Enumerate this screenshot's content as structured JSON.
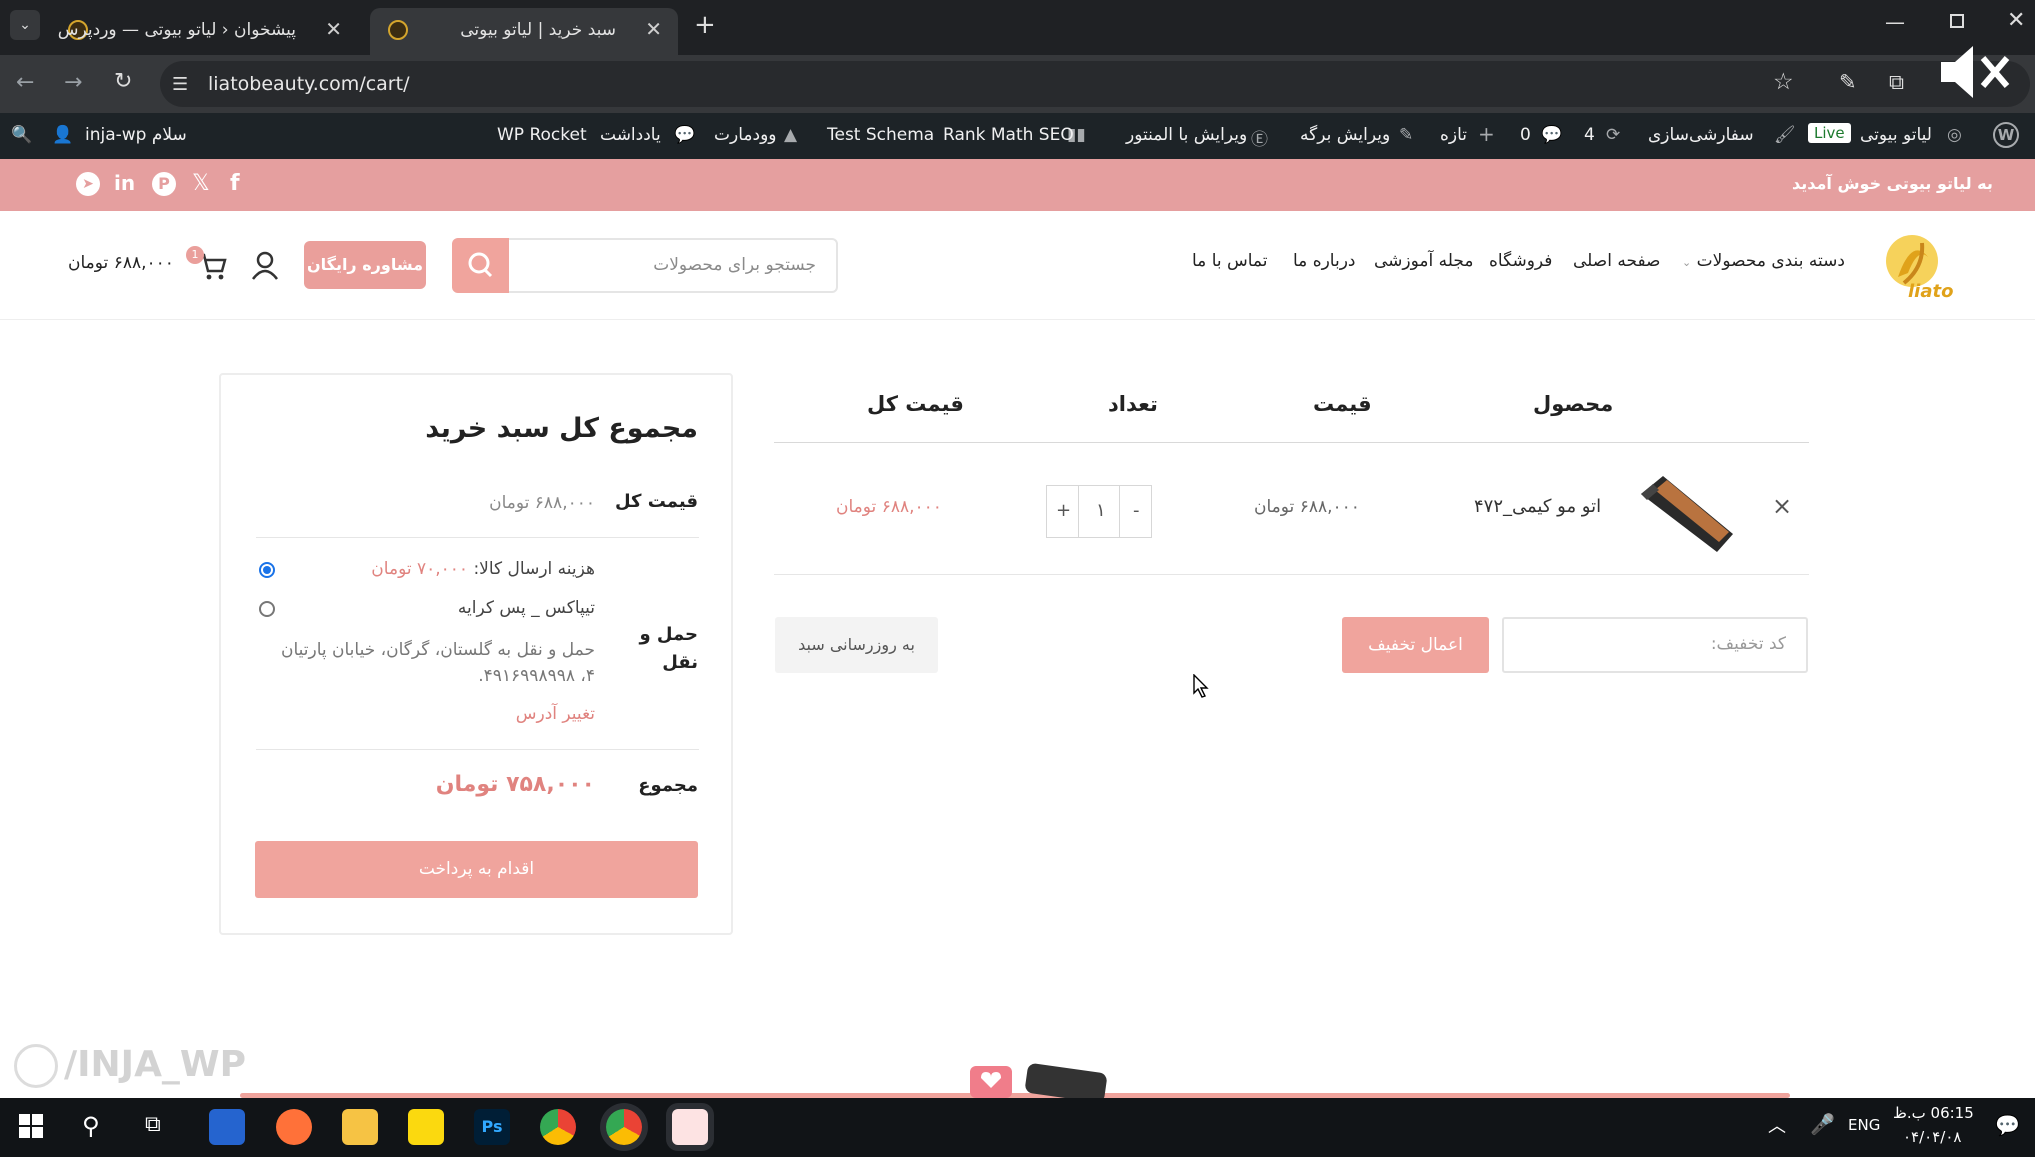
{
  "browser": {
    "tabs": [
      {
        "title": "پیشخوان ‹ لیاتو بیوتی — وردپرس"
      },
      {
        "title": "سبد خرید | لیاتو بیوتی"
      }
    ],
    "url": "liatobeauty.com/cart/"
  },
  "wp_admin_bar": {
    "site_name": "لیاتو بیوتی",
    "live_badge": "Live",
    "customize": "سفارشی‌سازی",
    "updates_count": "4",
    "comments_count": "0",
    "new": "تازه",
    "edit_page": "ویرایش برگه",
    "edit_elementor": "ویرایش با المنتور",
    "rank_math": "Rank Math SEO",
    "test_schema": "Test Schema",
    "woodmart": "وودمارت",
    "notes": "یادداشت",
    "wp_rocket": "WP Rocket",
    "greeting": "سلام inja-wp"
  },
  "site": {
    "welcome": "به لیاتو بیوتی خوش آمدید",
    "logo_text": "liato",
    "nav": [
      "دسته بندی محصولات",
      "صفحه اصلی",
      "فروشگاه",
      "مجله آموزشی",
      "درباره ما",
      "تماس با ما"
    ],
    "search_placeholder": "جستجو برای محصولات",
    "consult_button": "مشاوره رایگان",
    "cart_count": "1",
    "cart_total": "۶۸۸,۰۰۰",
    "currency": "تومان"
  },
  "cart": {
    "headers": {
      "product": "محصول",
      "price": "قیمت",
      "quantity": "تعداد",
      "subtotal": "قیمت کل"
    },
    "items": [
      {
        "name": "اتو مو کیمی_۴۷۲",
        "price": "۶۸۸,۰۰۰ تومان",
        "quantity": "۱",
        "subtotal": "۶۸۸,۰۰۰ تومان"
      }
    ],
    "qty_minus": "-",
    "qty_plus": "+",
    "remove": "×",
    "coupon_placeholder": "کد تخفیف:",
    "apply_coupon": "اعمال تخفیف",
    "update_cart": "به روزرسانی سبد"
  },
  "totals": {
    "title": "مجموع کل سبد خرید",
    "subtotal_label": "قیمت کل",
    "subtotal_value": "۶۸۸,۰۰۰ تومان",
    "shipping_label": "حمل و نقل",
    "shipping_option1_label": "هزینه ارسال کالا:",
    "shipping_option1_price": "۷۰,۰۰۰ تومان",
    "shipping_option1_selected": true,
    "shipping_option2_label": "تیپاکس _ پس کرایه",
    "shipping_address": "حمل و نقل به گلستان، گرگان، خیابان پارتیان ۴، ۴۹۱۶۹۹۸۹۹۸.",
    "change_address": "تغییر آدرس",
    "total_label": "مجموع",
    "total_value": "۷۵۸,۰۰۰ تومان",
    "checkout_button": "اقدام به پرداخت"
  },
  "watermark": "/INJA_WP",
  "taskbar": {
    "language": "ENG",
    "time": "06:15 ب.ظ",
    "date": "۰۴/۰۴/۰۸"
  },
  "colors": {
    "accent": "#f0a49d",
    "price_accent": "#e0837f",
    "top_strip": "#e59f9f"
  }
}
